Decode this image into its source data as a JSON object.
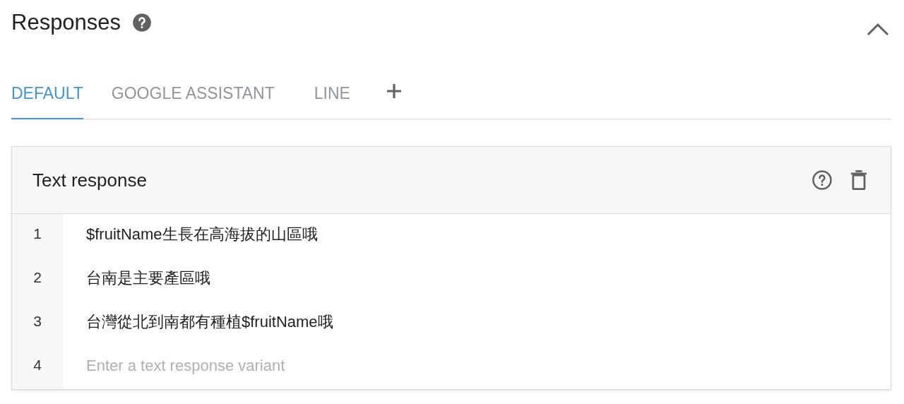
{
  "title": "Responses",
  "tabs": [
    {
      "label": "DEFAULT",
      "selected": true
    },
    {
      "label": "GOOGLE ASSISTANT",
      "selected": false
    },
    {
      "label": "LINE",
      "selected": false
    }
  ],
  "card": {
    "title": "Text response",
    "rows": [
      {
        "number": "1",
        "value": "$fruitName生長在高海拔的山區哦"
      },
      {
        "number": "2",
        "value": "台南是主要產區哦"
      },
      {
        "number": "3",
        "value": "台灣從北到南都有種植$fruitName哦"
      },
      {
        "number": "4",
        "placeholder": "Enter a text response variant"
      }
    ]
  }
}
